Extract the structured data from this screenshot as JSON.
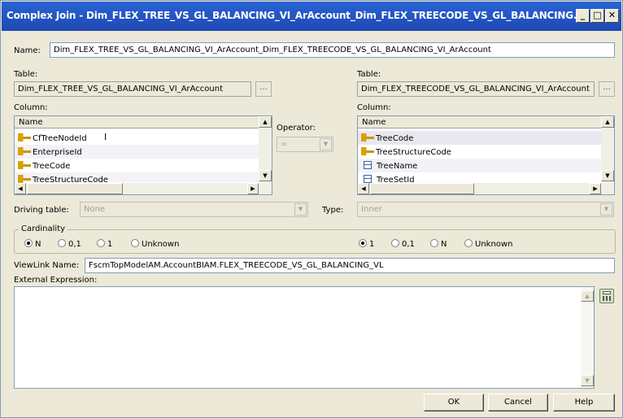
{
  "window": {
    "title": "Complex Join - Dim_FLEX_TREE_VS_GL_BALANCING_VI_ArAccount_Dim_FLEX_TREECODE_VS_GL_BALANCING...",
    "minimize_glyph": "_",
    "maximize_glyph": "□",
    "close_glyph": "✕"
  },
  "name": {
    "label": "Name:",
    "value": "Dim_FLEX_TREE_VS_GL_BALANCING_VI_ArAccount_Dim_FLEX_TREECODE_VS_GL_BALANCING_VI_ArAccount"
  },
  "left": {
    "table_label": "Table:",
    "table_value": "Dim_FLEX_TREE_VS_GL_BALANCING_VI_ArAccount",
    "browse_label": "...",
    "column_label": "Column:",
    "column_header": "Name",
    "columns": [
      {
        "name": "CfTreeNodeId",
        "icon": "key-icon"
      },
      {
        "name": "EnterpriseId",
        "icon": "key-icon"
      },
      {
        "name": "TreeCode",
        "icon": "key-icon"
      },
      {
        "name": "TreeStructureCode",
        "icon": "key-icon"
      }
    ]
  },
  "operator": {
    "label": "Operator:",
    "value": "="
  },
  "right": {
    "table_label": "Table:",
    "table_value": "Dim_FLEX_TREECODE_VS_GL_BALANCING_VI_ArAccount",
    "browse_label": "...",
    "column_label": "Column:",
    "column_header": "Name",
    "columns": [
      {
        "name": "TreeCode",
        "icon": "key-icon"
      },
      {
        "name": "TreeStructureCode",
        "icon": "key-icon"
      },
      {
        "name": "TreeName",
        "icon": "column-icon"
      },
      {
        "name": "TreeSetId",
        "icon": "column-icon"
      }
    ]
  },
  "driving_table": {
    "label": "Driving table:",
    "value": "None"
  },
  "type": {
    "label": "Type:",
    "value": "Inner"
  },
  "cardinality": {
    "label": "Cardinality",
    "left_options": [
      "N",
      "0,1",
      "1",
      "Unknown"
    ],
    "left_selected": "N",
    "right_options": [
      "1",
      "0,1",
      "N",
      "Unknown"
    ],
    "right_selected": "1"
  },
  "viewlink": {
    "label": "ViewLink Name:",
    "value": "FscmTopModelAM.AccountBIAM.FLEX_TREECODE_VS_GL_BALANCING_VL"
  },
  "external_expression": {
    "label": "External Expression:",
    "value": ""
  },
  "buttons": {
    "ok": "OK",
    "cancel": "Cancel",
    "help": "Help"
  },
  "colors": {
    "title_bar": "#2a63d4",
    "dialog_bg": "#ece9d8",
    "key_icon": "#d7a200",
    "column_icon": "#3a5fa8"
  }
}
